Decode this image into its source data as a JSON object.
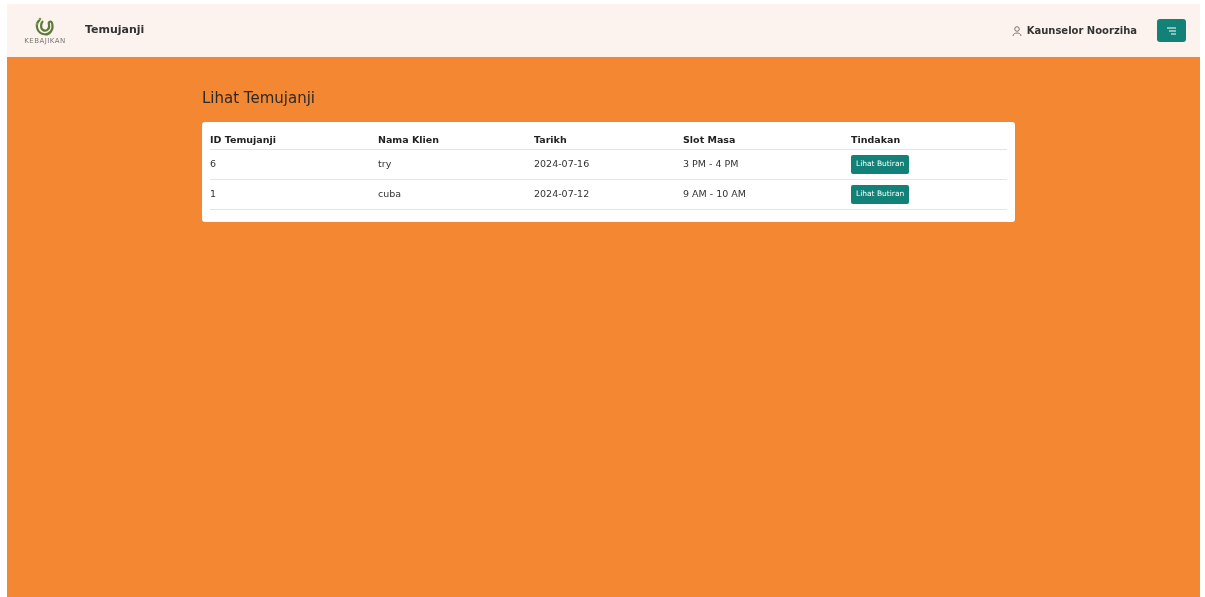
{
  "header": {
    "logo_text": "KEBAJIKAN",
    "title": "Temujanji",
    "user": "Kaunselor Noorziha"
  },
  "page_title": "Lihat Temujanji",
  "table": {
    "columns": [
      "ID Temujanji",
      "Nama Klien",
      "Tarikh",
      "Slot Masa",
      "Tindakan"
    ],
    "rows": [
      {
        "id": "6",
        "client": "try",
        "date": "2024-07-16",
        "slot": "3 PM - 4 PM",
        "action": "Lihat Butiran"
      },
      {
        "id": "1",
        "client": "cuba",
        "date": "2024-07-12",
        "slot": "9 AM - 10 AM",
        "action": "Lihat Butiran"
      }
    ]
  }
}
